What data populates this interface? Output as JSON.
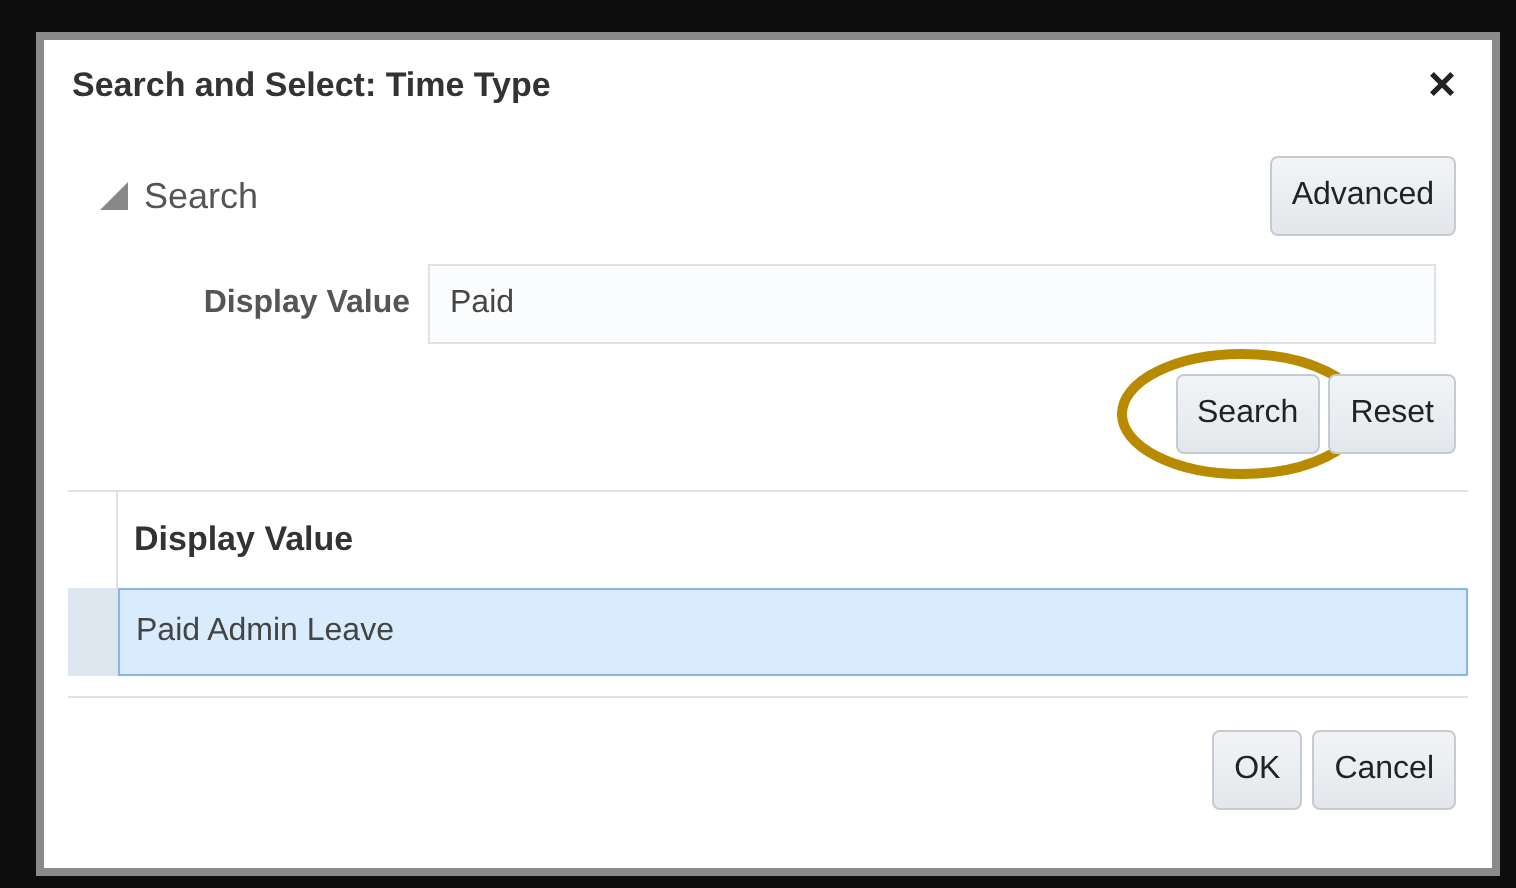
{
  "dialog": {
    "title": "Search and Select: Time Type",
    "close": "×"
  },
  "search_panel": {
    "label": "Search",
    "expanded": true,
    "advanced_button": "Advanced",
    "fields": [
      {
        "label": "Display Value",
        "value": "Paid"
      }
    ],
    "buttons": [
      {
        "label": "Search",
        "highlighted": true
      },
      {
        "label": "Reset",
        "highlighted": false
      }
    ]
  },
  "table": {
    "columns": [
      "Display Value"
    ],
    "rows": [
      {
        "cells": [
          "Paid Admin Leave"
        ],
        "selected": true
      }
    ]
  },
  "footer_buttons": [
    "OK",
    "Cancel"
  ]
}
